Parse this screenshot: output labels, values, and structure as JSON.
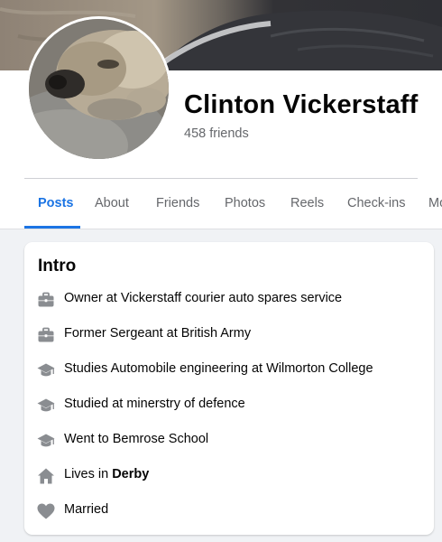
{
  "profile": {
    "name": "Clinton Vickerstaff",
    "friends": "458 friends"
  },
  "tabs": [
    {
      "label": "Posts",
      "active": true
    },
    {
      "label": "About"
    },
    {
      "label": "Friends"
    },
    {
      "label": "Photos"
    },
    {
      "label": "Reels"
    },
    {
      "label": "Check-ins"
    },
    {
      "label": "Mo"
    }
  ],
  "intro": {
    "title": "Intro",
    "items": [
      {
        "icon": "briefcase-icon",
        "text": "Owner at Vickerstaff courier auto spares service"
      },
      {
        "icon": "briefcase-icon",
        "text": "Former Sergeant at British Army"
      },
      {
        "icon": "graduation-cap-icon",
        "text": "Studies Automobile engineering at Wilmorton College"
      },
      {
        "icon": "graduation-cap-icon",
        "text": "Studied at minerstry of defence"
      },
      {
        "icon": "graduation-cap-icon",
        "text": "Went to Bemrose School"
      },
      {
        "icon": "home-icon",
        "prefix": "Lives in ",
        "bold": "Derby"
      },
      {
        "icon": "heart-icon",
        "text": "Married"
      }
    ]
  },
  "colors": {
    "accent": "#1b74e4",
    "secondary_text": "#65676b",
    "icon": "#8a8d91",
    "background": "#f0f2f5"
  }
}
